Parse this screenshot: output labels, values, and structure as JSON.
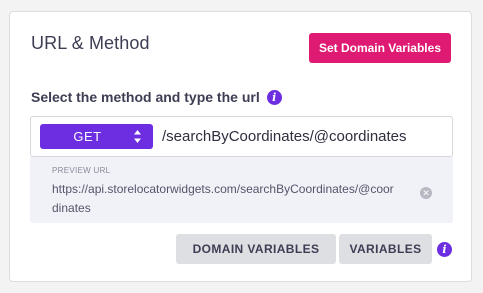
{
  "card": {
    "title": "URL & Method",
    "set_domain_variables_label": "Set Domain Variables"
  },
  "url_field": {
    "label": "Select the method and type the url",
    "method": "GET",
    "value": "/searchByCoordinates/@coordinates"
  },
  "preview": {
    "label": "PREVIEW URL",
    "url": "https://api.storelocatorwidgets.com/searchByCoordinates/@coordinates"
  },
  "buttons": {
    "domain_variables_label": "DOMAIN VARIABLES",
    "variables_label": "VARIABLES"
  },
  "icons": {
    "info": "info-icon",
    "clear": "clear-icon",
    "updown": "updown-arrows-icon"
  },
  "colors": {
    "accent_purple": "#6c2ee0",
    "accent_pink": "#de1a73"
  }
}
